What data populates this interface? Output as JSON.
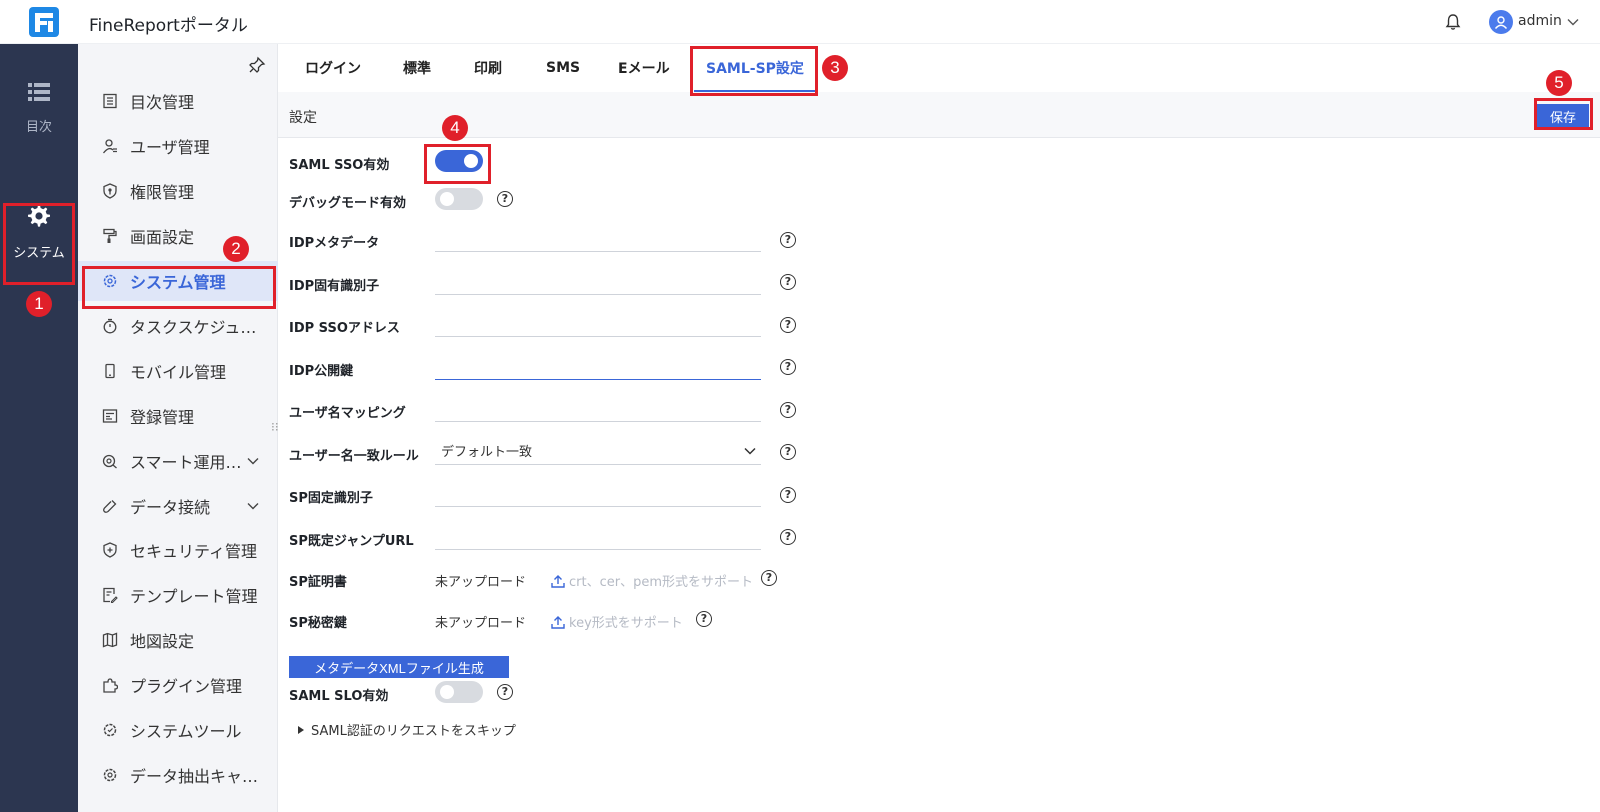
{
  "app": {
    "title": "FineReportポータル",
    "user": "admin"
  },
  "rail": {
    "items": [
      {
        "label": "目次",
        "icon": "list-icon"
      },
      {
        "label": "システム",
        "icon": "gear-icon",
        "active": true
      }
    ]
  },
  "sidebar": {
    "items": [
      {
        "label": "目次管理",
        "icon": "directory-icon"
      },
      {
        "label": "ユーザ管理",
        "icon": "user-icon"
      },
      {
        "label": "権限管理",
        "icon": "shield-icon"
      },
      {
        "label": "画面設定",
        "icon": "paint-roller-icon"
      },
      {
        "label": "システム管理",
        "icon": "gear-icon",
        "active": true
      },
      {
        "label": "タスクスケジューラ",
        "icon": "timer-icon"
      },
      {
        "label": "モバイル管理",
        "icon": "mobile-icon"
      },
      {
        "label": "登録管理",
        "icon": "register-icon"
      },
      {
        "label": "スマート運用…",
        "icon": "smart-ops-icon",
        "expandable": true
      },
      {
        "label": "データ接続",
        "icon": "link-icon",
        "expandable": true
      },
      {
        "label": "セキュリティ管理",
        "icon": "security-icon"
      },
      {
        "label": "テンプレート管理",
        "icon": "template-icon"
      },
      {
        "label": "地図設定",
        "icon": "map-icon"
      },
      {
        "label": "プラグイン管理",
        "icon": "plugin-icon"
      },
      {
        "label": "システムツール",
        "icon": "tool-icon"
      },
      {
        "label": "データ抽出キャッ…",
        "icon": "cache-icon"
      }
    ]
  },
  "tabs": [
    {
      "label": "ログイン"
    },
    {
      "label": "標準"
    },
    {
      "label": "印刷"
    },
    {
      "label": "SMS"
    },
    {
      "label": "Eメール"
    },
    {
      "label": "SAML-SP設定",
      "active": true
    }
  ],
  "section": {
    "title": "設定",
    "save_label": "保存"
  },
  "form": {
    "saml_sso_label": "SAML SSO有効",
    "saml_sso_on": true,
    "debug_label": "デバッグモード有効",
    "debug_on": false,
    "idp_metadata_label": "IDPメタデータ",
    "idp_identifier_label": "IDP固有識別子",
    "idp_sso_label": "IDP SSOアドレス",
    "idp_pubkey_label": "IDP公開鍵",
    "username_mapping_label": "ユーザ名マッピング",
    "username_rule_label": "ユーザー名一致ルール",
    "username_rule_value": "デフォルト一致",
    "sp_identifier_label": "SP固定識別子",
    "sp_jump_url_label": "SP既定ジャンプURL",
    "sp_cert_label": "SP証明書",
    "sp_cert_status": "未アップロード",
    "sp_cert_hint": "crt、cer、pem形式をサポート",
    "sp_key_label": "SP秘密鍵",
    "sp_key_status": "未アップロード",
    "sp_key_hint": "key形式をサポート",
    "generate_label": "メタデータXMLファイル生成",
    "saml_slo_label": "SAML SLO有効",
    "saml_slo_on": false,
    "skip_label": "SAML認証のリクエストをスキップ"
  },
  "annotations": [
    "1",
    "2",
    "3",
    "4",
    "5"
  ],
  "colors": {
    "accent": "#3a66d8",
    "rail": "#2c3650",
    "annotation": "#e0202a"
  }
}
